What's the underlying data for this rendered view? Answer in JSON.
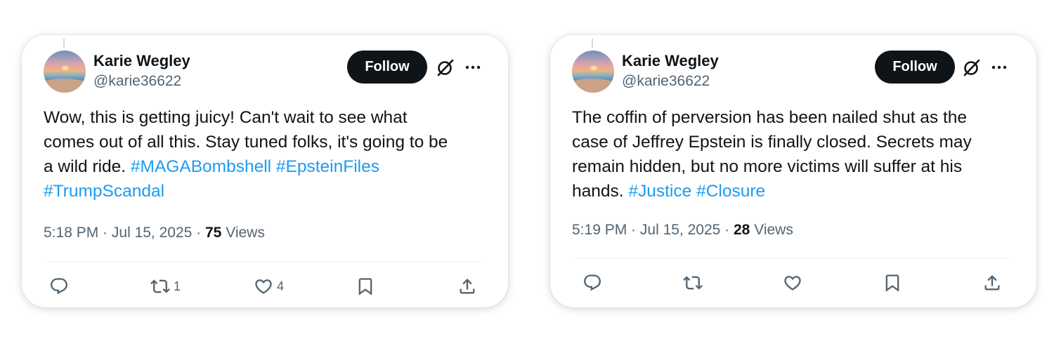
{
  "tweets": [
    {
      "author": {
        "name": "Karie Wegley",
        "handle": "@karie36622"
      },
      "follow_label": "Follow",
      "text_lines": [
        "Wow, this is getting juicy! Can't wait to see what",
        "comes out of all this. Stay tuned folks, it's going to be",
        "a wild ride. "
      ],
      "hashtags": [
        "#MAGABombshell",
        "#EpsteinFiles",
        "#TrumpScandal"
      ],
      "meta": {
        "time": "5:18 PM",
        "sep1": " · ",
        "date": "Jul 15, 2025",
        "sep2": " · ",
        "views_count": "75",
        "views_label": " Views"
      },
      "actions": {
        "replies": "",
        "reposts": "1",
        "likes": "4"
      }
    },
    {
      "author": {
        "name": "Karie Wegley",
        "handle": "@karie36622"
      },
      "follow_label": "Follow",
      "text_lines": [
        "The coffin of perversion has been nailed shut as the",
        "case of Jeffrey Epstein is finally closed. Secrets may",
        "remain hidden, but no more victims will suffer at his",
        "hands. "
      ],
      "hashtags": [
        "#Justice",
        "#Closure"
      ],
      "meta": {
        "time": "5:19 PM",
        "sep1": " · ",
        "date": "Jul 15, 2025",
        "sep2": " · ",
        "views_count": "28",
        "views_label": " Views"
      },
      "actions": {
        "replies": "",
        "reposts": "",
        "likes": ""
      }
    }
  ],
  "icons": [
    "reply-icon",
    "repost-icon",
    "like-icon",
    "bookmark-icon",
    "share-icon",
    "grok-icon",
    "more-icon"
  ],
  "colors": {
    "accent": "#1d9bf0",
    "text": "#0f1419",
    "muted": "#536471",
    "button": "#0f1419"
  }
}
